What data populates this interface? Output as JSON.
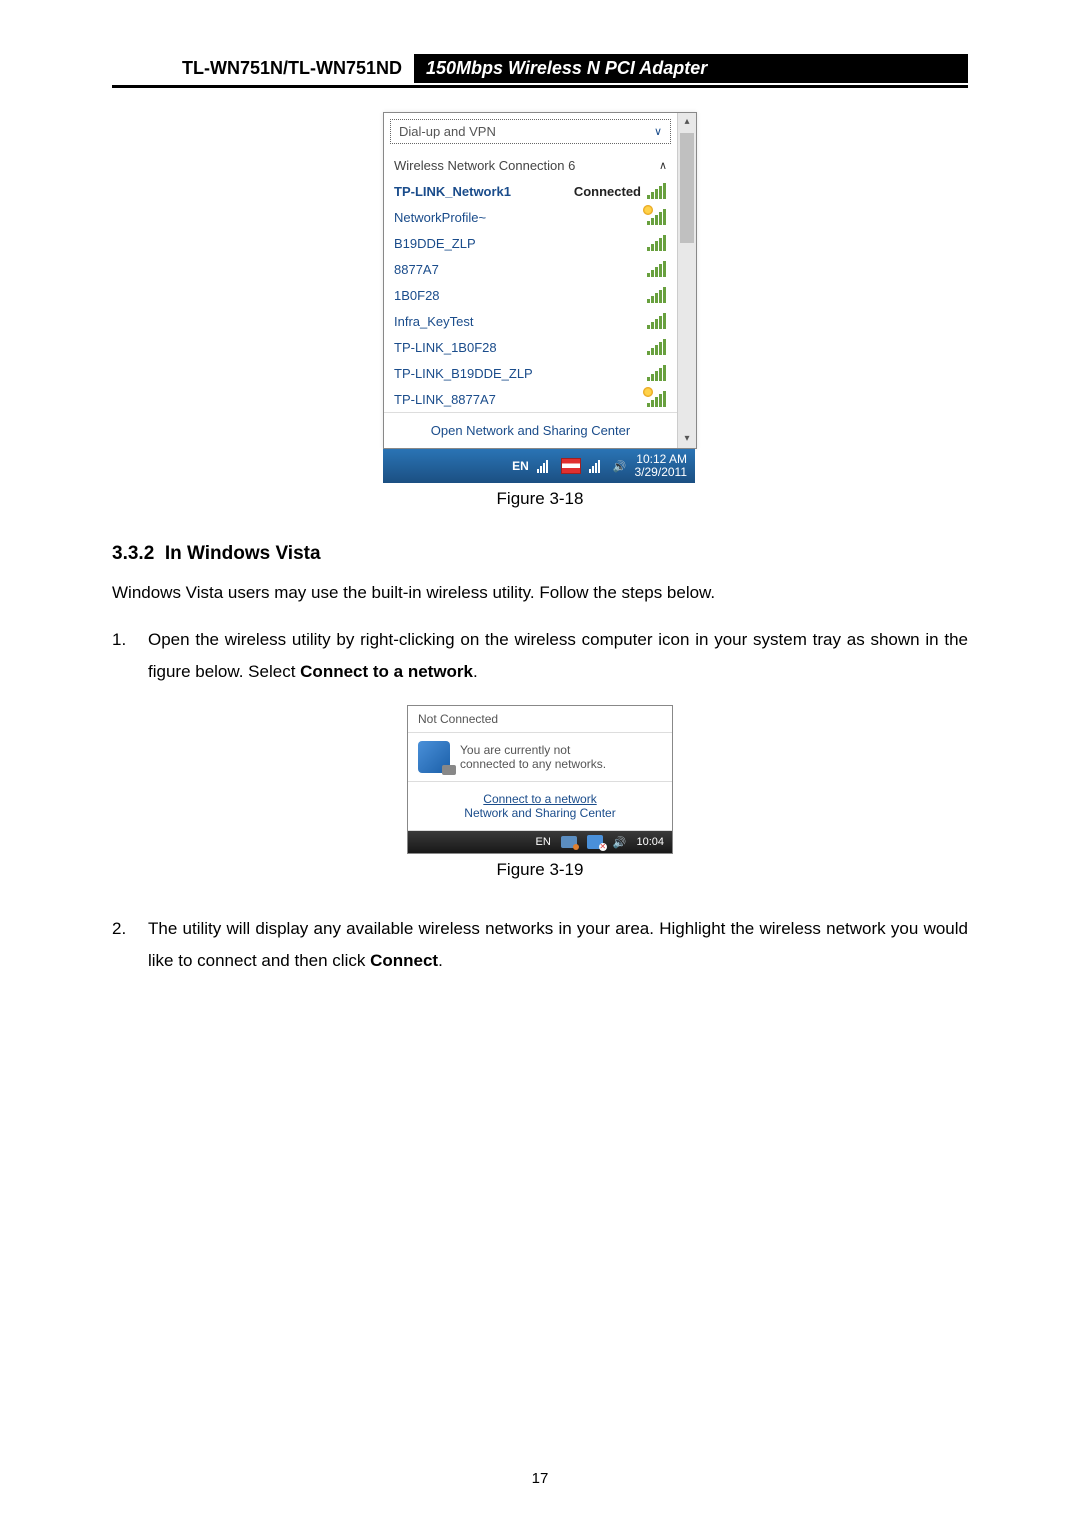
{
  "header": {
    "left": "TL-WN751N/TL-WN751ND",
    "right": "150Mbps Wireless N PCI Adapter"
  },
  "fig18": {
    "caption": "Figure 3-18",
    "dialup": "Dial-up and VPN",
    "conn_header": "Wireless Network Connection 6",
    "networks": [
      {
        "name": "TP-LINK_Network1",
        "status": "Connected",
        "shield": false,
        "bold": true
      },
      {
        "name": "NetworkProfile~",
        "status": "",
        "shield": true,
        "bold": false
      },
      {
        "name": "B19DDE_ZLP",
        "status": "",
        "shield": false,
        "bold": false
      },
      {
        "name": "8877A7",
        "status": "",
        "shield": false,
        "bold": false
      },
      {
        "name": "1B0F28",
        "status": "",
        "shield": false,
        "bold": false
      },
      {
        "name": "Infra_KeyTest",
        "status": "",
        "shield": false,
        "bold": false
      },
      {
        "name": "TP-LINK_1B0F28",
        "status": "",
        "shield": false,
        "bold": false
      },
      {
        "name": "TP-LINK_B19DDE_ZLP",
        "status": "",
        "shield": false,
        "bold": false
      },
      {
        "name": "TP-LINK_8877A7",
        "status": "",
        "shield": true,
        "bold": false
      }
    ],
    "open_center": "Open Network and Sharing Center",
    "taskbar": {
      "lang": "EN",
      "time": "10:12 AM",
      "date": "3/29/2011"
    }
  },
  "section": {
    "number": "3.3.2",
    "title": "In Windows Vista"
  },
  "para1": "Windows Vista users may use the built-in wireless utility. Follow the steps below.",
  "step1": {
    "num": "1.",
    "text_a": "Open the wireless utility by right-clicking on the wireless computer icon in your system tray as shown in the figure below. Select ",
    "bold": "Connect to a network",
    "text_b": "."
  },
  "fig19": {
    "caption": "Figure 3-19",
    "not_connected": "Not Connected",
    "msg_l1": "You are currently not",
    "msg_l2": "connected to any networks.",
    "connect_link": "Connect to a network",
    "sharing_center": "Network and Sharing Center",
    "lang": "EN",
    "time": "10:04"
  },
  "step2": {
    "num": "2.",
    "text_a": "The utility will display any available wireless networks in your area. Highlight the wireless network you would like to connect and then click ",
    "bold": "Connect",
    "text_b": "."
  },
  "page_number": "17"
}
